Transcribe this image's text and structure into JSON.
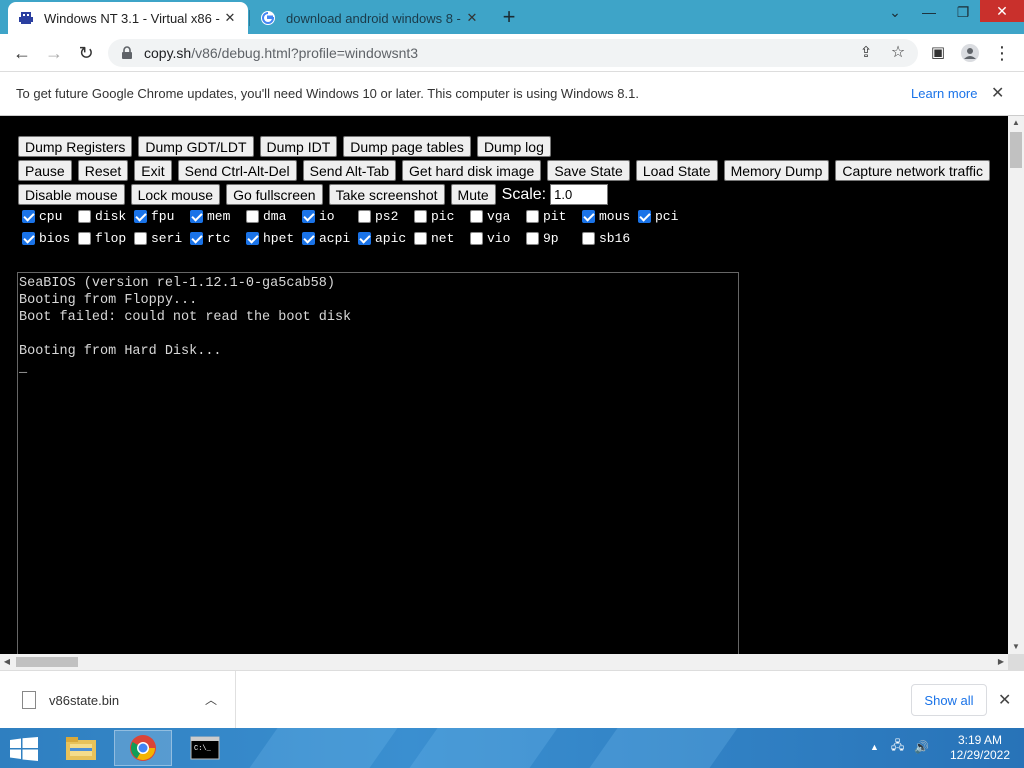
{
  "browser": {
    "tabs": [
      {
        "title": "Windows NT 3.1 - Virtual x86 - d",
        "favicon": "v86-icon",
        "active": true
      },
      {
        "title": "download android windows 8 - G",
        "favicon": "google-icon",
        "active": false
      }
    ],
    "url_host": "copy.sh",
    "url_path": "/v86/debug.html?profile=windowsnt3",
    "infobar": {
      "message": "To get future Google Chrome updates, you'll need Windows 10 or later. This computer is using Windows 8.1.",
      "link": "Learn more"
    }
  },
  "page": {
    "buttons_row1": [
      "Dump Registers",
      "Dump GDT/LDT",
      "Dump IDT",
      "Dump page tables",
      "Dump log"
    ],
    "buttons_row2": [
      "Pause",
      "Reset",
      "Exit",
      "Send Ctrl-Alt-Del",
      "Send Alt-Tab",
      "Get hard disk image",
      "Save State",
      "Load State",
      "Memory Dump",
      "Capture network traffic"
    ],
    "buttons_row3": [
      "Disable mouse",
      "Lock mouse",
      "Go fullscreen",
      "Take screenshot",
      "Mute"
    ],
    "scale_label": "Scale:",
    "scale_value": "1.0",
    "checkboxes_row1": [
      {
        "label": "cpu",
        "checked": true
      },
      {
        "label": "disk",
        "checked": false
      },
      {
        "label": "fpu",
        "checked": true
      },
      {
        "label": "mem",
        "checked": true
      },
      {
        "label": "dma",
        "checked": false
      },
      {
        "label": "io",
        "checked": true
      },
      {
        "label": "ps2",
        "checked": false
      },
      {
        "label": "pic",
        "checked": false
      },
      {
        "label": "vga",
        "checked": false
      },
      {
        "label": "pit",
        "checked": false
      },
      {
        "label": "mous",
        "checked": true
      },
      {
        "label": "pci",
        "checked": true
      }
    ],
    "checkboxes_row2": [
      {
        "label": "bios",
        "checked": true
      },
      {
        "label": "flop",
        "checked": false
      },
      {
        "label": "seri",
        "checked": false
      },
      {
        "label": "rtc",
        "checked": true
      },
      {
        "label": "hpet",
        "checked": true
      },
      {
        "label": "acpi",
        "checked": true
      },
      {
        "label": "apic",
        "checked": true
      },
      {
        "label": "net",
        "checked": false
      },
      {
        "label": "vio",
        "checked": false
      },
      {
        "label": "9p",
        "checked": false
      },
      {
        "label": "sb16",
        "checked": false
      }
    ],
    "screen_lines": [
      "SeaBIOS (version rel-1.12.1-0-ga5cab58)",
      "Booting from Floppy...",
      "Boot failed: could not read the boot disk",
      "",
      "Booting from Hard Disk...",
      "_"
    ]
  },
  "downloads": {
    "file": "v86state.bin",
    "show_all": "Show all"
  },
  "taskbar": {
    "time": "3:19 AM",
    "date": "12/29/2022"
  }
}
